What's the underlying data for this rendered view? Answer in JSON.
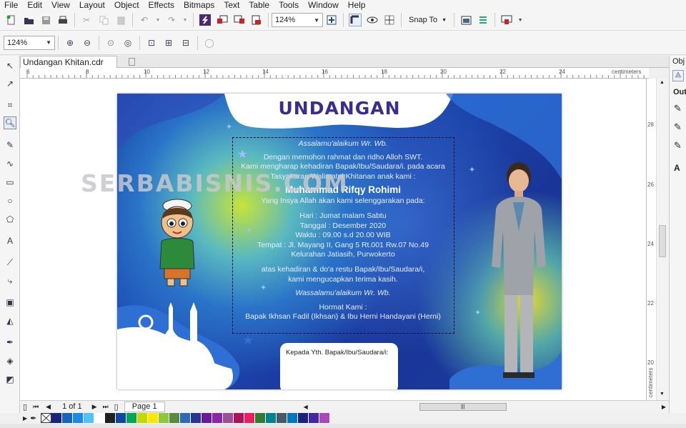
{
  "menu": [
    "File",
    "Edit",
    "View",
    "Layout",
    "Object",
    "Effects",
    "Bitmaps",
    "Text",
    "Table",
    "Tools",
    "Window",
    "Help"
  ],
  "toolbar": {
    "zoom_value": "124%",
    "snap_label": "Snap To"
  },
  "propertybar": {
    "zoom_value": "124%"
  },
  "document_tab": "Undangan Khitan.cdr",
  "hruler": {
    "ticks": [
      "6",
      "8",
      "10",
      "12",
      "14",
      "16",
      "18",
      "20",
      "22",
      "24"
    ],
    "unit": "centimeters"
  },
  "vruler": {
    "ticks": [
      "28",
      "26",
      "24",
      "22",
      "20"
    ],
    "unit": "centimeters"
  },
  "card": {
    "title": "UNDANGAN",
    "greeting": "Assalamu'alaikum Wr. Wb.",
    "intro1": "Dengan memohon rahmat dan ridho Alloh SWT.",
    "intro2": "Kami mengharap kehadiran Bapak/Ibu/Saudara/i. pada acara",
    "intro3": "Tasyakuran Walimatul Khitanan anak kami :",
    "child_name": "Muhammad Rifqy Rohimi",
    "insya": "Yang Insya Allah akan kami selenggarakan pada:",
    "hari": "Hari : Jumat malam Sabtu",
    "tanggal": "Tanggal : Desember 2020",
    "waktu": "Waktu : 09.00 s.d 20.00 WIB",
    "tempat1": "Tempat : Jl. Mayang II, Gang 5 Rt.001 Rw.07 No.49",
    "tempat2": "Kelurahan Jatiasih, Purwokerto",
    "atas1": "atas kehadiran & do'a restu Bapak/Ibu/Saudara/i,",
    "atas2": "kami mengucapkan terima kasih.",
    "closing": "Wassalamu'alaikum Wr. Wb.",
    "hormat": "Hormat Kami :",
    "parents": "Bapak Ikhsan Fadil (Ikhsan) & Ibu Herni Handayani (Herni)",
    "kepada": "Kepada Yth. Bapak/Ibu/Saudara/i:"
  },
  "watermark": "SERBABISNIS.COM",
  "pagebar": {
    "page_count": "1 of 1",
    "page_tab": "Page 1"
  },
  "docker": {
    "label_top": "Obj",
    "label_out": "Out"
  },
  "palette": [
    "#1a237e",
    "#1565c0",
    "#1e88e5",
    "#4fc3f7",
    "#ffffff",
    "#212121",
    "#0d47a1",
    "#00a651",
    "#c6d800",
    "#ffe600",
    "#8dc63f",
    "#5c8a3a",
    "#2c6bb5",
    "#283593",
    "#6a1b9a",
    "#8e24aa",
    "#9c4f96",
    "#ad1457",
    "#e91e63",
    "#2e7d32",
    "#00838f",
    "#455a64",
    "#0277bd",
    "#1a237e",
    "#4527a0",
    "#ab47bc",
    "#d81b60",
    "#6d4c41",
    "#9e9d24",
    "#c2185b",
    "#6a1b4d",
    "#7b1fa2",
    "#880e4f",
    "#3e2723",
    "#4e342e",
    "#263238"
  ]
}
